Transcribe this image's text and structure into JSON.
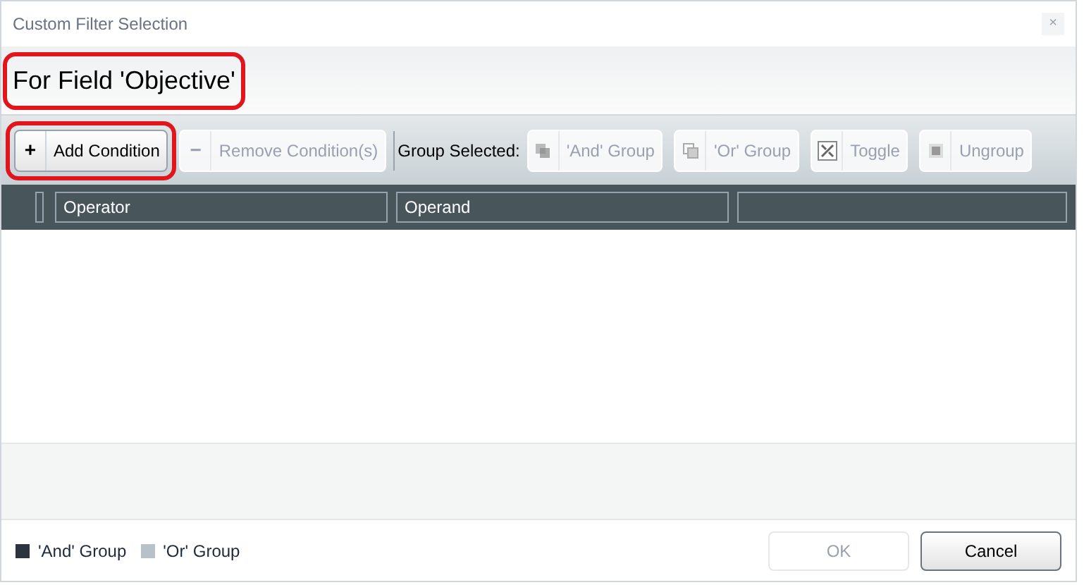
{
  "window": {
    "title": "Custom Filter Selection",
    "close": "×"
  },
  "header": {
    "title": "For Field 'Objective'",
    "highlighted": true
  },
  "toolbar": {
    "buttons": [
      {
        "icon": "+",
        "label": "Add Condition",
        "disabled": false,
        "highlighted": true
      },
      {
        "icon": "−",
        "label": "Remove Condition(s)",
        "disabled": true,
        "highlighted": false
      }
    ],
    "group_label": "Group Selected:",
    "group_buttons": [
      {
        "label": "'And' Group",
        "disabled": true,
        "kind": "and"
      },
      {
        "label": "'Or' Group",
        "disabled": true,
        "kind": "or"
      },
      {
        "label": "Toggle",
        "disabled": true,
        "kind": "toggle"
      },
      {
        "label": "Ungroup",
        "disabled": true,
        "kind": "ungroup"
      }
    ]
  },
  "table": {
    "columns": [
      "Operator",
      "Operand"
    ]
  },
  "legend": [
    {
      "label": "'And' Group",
      "color": "#2d3440"
    },
    {
      "label": "'Or' Group",
      "color": "#b8c0c8"
    }
  ],
  "buttons": [
    {
      "label": "OK",
      "disabled": true
    },
    {
      "label": "Cancel",
      "disabled": false
    }
  ]
}
